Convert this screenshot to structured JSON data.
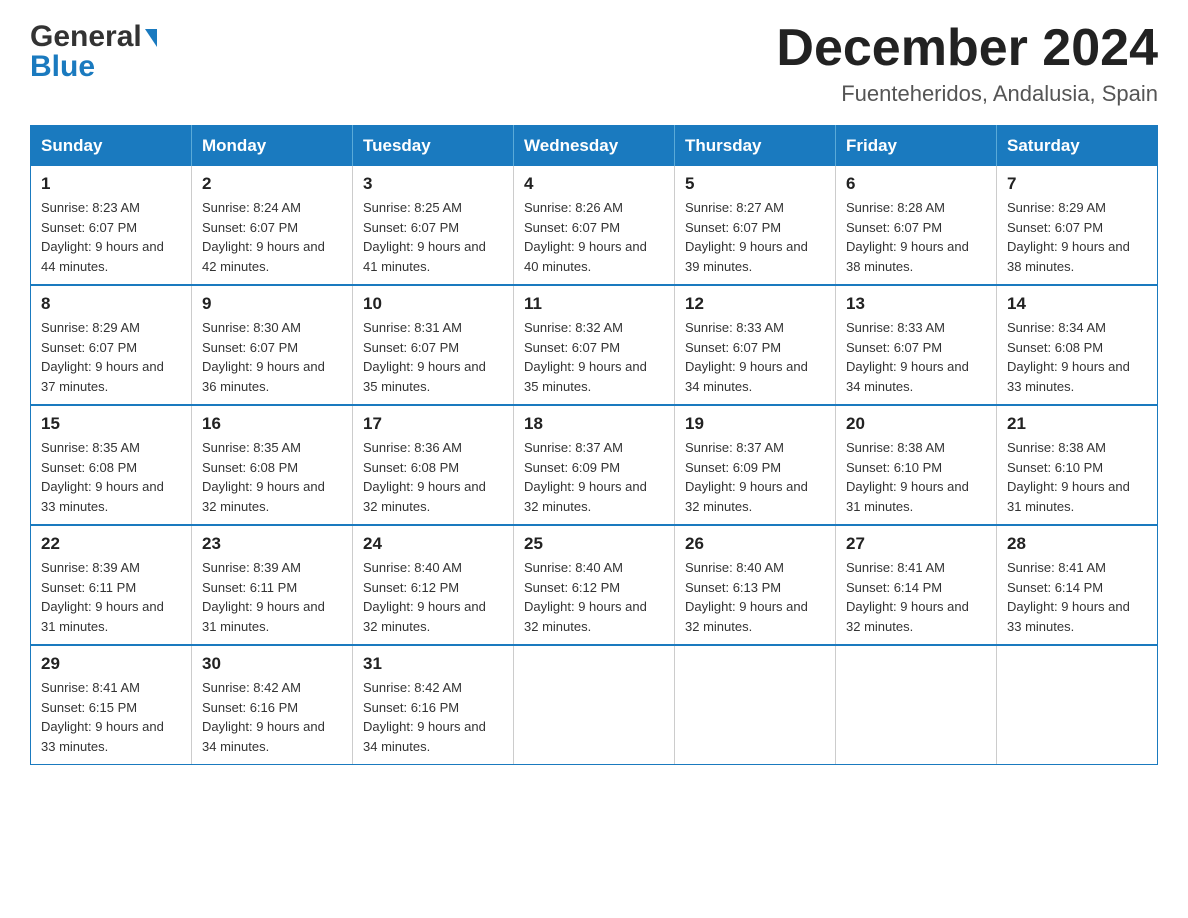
{
  "header": {
    "logo_general": "General",
    "logo_blue": "Blue",
    "main_title": "December 2024",
    "subtitle": "Fuenteheridos, Andalusia, Spain"
  },
  "calendar": {
    "days_of_week": [
      "Sunday",
      "Monday",
      "Tuesday",
      "Wednesday",
      "Thursday",
      "Friday",
      "Saturday"
    ],
    "weeks": [
      [
        {
          "day": "1",
          "sunrise": "Sunrise: 8:23 AM",
          "sunset": "Sunset: 6:07 PM",
          "daylight": "Daylight: 9 hours and 44 minutes."
        },
        {
          "day": "2",
          "sunrise": "Sunrise: 8:24 AM",
          "sunset": "Sunset: 6:07 PM",
          "daylight": "Daylight: 9 hours and 42 minutes."
        },
        {
          "day": "3",
          "sunrise": "Sunrise: 8:25 AM",
          "sunset": "Sunset: 6:07 PM",
          "daylight": "Daylight: 9 hours and 41 minutes."
        },
        {
          "day": "4",
          "sunrise": "Sunrise: 8:26 AM",
          "sunset": "Sunset: 6:07 PM",
          "daylight": "Daylight: 9 hours and 40 minutes."
        },
        {
          "day": "5",
          "sunrise": "Sunrise: 8:27 AM",
          "sunset": "Sunset: 6:07 PM",
          "daylight": "Daylight: 9 hours and 39 minutes."
        },
        {
          "day": "6",
          "sunrise": "Sunrise: 8:28 AM",
          "sunset": "Sunset: 6:07 PM",
          "daylight": "Daylight: 9 hours and 38 minutes."
        },
        {
          "day": "7",
          "sunrise": "Sunrise: 8:29 AM",
          "sunset": "Sunset: 6:07 PM",
          "daylight": "Daylight: 9 hours and 38 minutes."
        }
      ],
      [
        {
          "day": "8",
          "sunrise": "Sunrise: 8:29 AM",
          "sunset": "Sunset: 6:07 PM",
          "daylight": "Daylight: 9 hours and 37 minutes."
        },
        {
          "day": "9",
          "sunrise": "Sunrise: 8:30 AM",
          "sunset": "Sunset: 6:07 PM",
          "daylight": "Daylight: 9 hours and 36 minutes."
        },
        {
          "day": "10",
          "sunrise": "Sunrise: 8:31 AM",
          "sunset": "Sunset: 6:07 PM",
          "daylight": "Daylight: 9 hours and 35 minutes."
        },
        {
          "day": "11",
          "sunrise": "Sunrise: 8:32 AM",
          "sunset": "Sunset: 6:07 PM",
          "daylight": "Daylight: 9 hours and 35 minutes."
        },
        {
          "day": "12",
          "sunrise": "Sunrise: 8:33 AM",
          "sunset": "Sunset: 6:07 PM",
          "daylight": "Daylight: 9 hours and 34 minutes."
        },
        {
          "day": "13",
          "sunrise": "Sunrise: 8:33 AM",
          "sunset": "Sunset: 6:07 PM",
          "daylight": "Daylight: 9 hours and 34 minutes."
        },
        {
          "day": "14",
          "sunrise": "Sunrise: 8:34 AM",
          "sunset": "Sunset: 6:08 PM",
          "daylight": "Daylight: 9 hours and 33 minutes."
        }
      ],
      [
        {
          "day": "15",
          "sunrise": "Sunrise: 8:35 AM",
          "sunset": "Sunset: 6:08 PM",
          "daylight": "Daylight: 9 hours and 33 minutes."
        },
        {
          "day": "16",
          "sunrise": "Sunrise: 8:35 AM",
          "sunset": "Sunset: 6:08 PM",
          "daylight": "Daylight: 9 hours and 32 minutes."
        },
        {
          "day": "17",
          "sunrise": "Sunrise: 8:36 AM",
          "sunset": "Sunset: 6:08 PM",
          "daylight": "Daylight: 9 hours and 32 minutes."
        },
        {
          "day": "18",
          "sunrise": "Sunrise: 8:37 AM",
          "sunset": "Sunset: 6:09 PM",
          "daylight": "Daylight: 9 hours and 32 minutes."
        },
        {
          "day": "19",
          "sunrise": "Sunrise: 8:37 AM",
          "sunset": "Sunset: 6:09 PM",
          "daylight": "Daylight: 9 hours and 32 minutes."
        },
        {
          "day": "20",
          "sunrise": "Sunrise: 8:38 AM",
          "sunset": "Sunset: 6:10 PM",
          "daylight": "Daylight: 9 hours and 31 minutes."
        },
        {
          "day": "21",
          "sunrise": "Sunrise: 8:38 AM",
          "sunset": "Sunset: 6:10 PM",
          "daylight": "Daylight: 9 hours and 31 minutes."
        }
      ],
      [
        {
          "day": "22",
          "sunrise": "Sunrise: 8:39 AM",
          "sunset": "Sunset: 6:11 PM",
          "daylight": "Daylight: 9 hours and 31 minutes."
        },
        {
          "day": "23",
          "sunrise": "Sunrise: 8:39 AM",
          "sunset": "Sunset: 6:11 PM",
          "daylight": "Daylight: 9 hours and 31 minutes."
        },
        {
          "day": "24",
          "sunrise": "Sunrise: 8:40 AM",
          "sunset": "Sunset: 6:12 PM",
          "daylight": "Daylight: 9 hours and 32 minutes."
        },
        {
          "day": "25",
          "sunrise": "Sunrise: 8:40 AM",
          "sunset": "Sunset: 6:12 PM",
          "daylight": "Daylight: 9 hours and 32 minutes."
        },
        {
          "day": "26",
          "sunrise": "Sunrise: 8:40 AM",
          "sunset": "Sunset: 6:13 PM",
          "daylight": "Daylight: 9 hours and 32 minutes."
        },
        {
          "day": "27",
          "sunrise": "Sunrise: 8:41 AM",
          "sunset": "Sunset: 6:14 PM",
          "daylight": "Daylight: 9 hours and 32 minutes."
        },
        {
          "day": "28",
          "sunrise": "Sunrise: 8:41 AM",
          "sunset": "Sunset: 6:14 PM",
          "daylight": "Daylight: 9 hours and 33 minutes."
        }
      ],
      [
        {
          "day": "29",
          "sunrise": "Sunrise: 8:41 AM",
          "sunset": "Sunset: 6:15 PM",
          "daylight": "Daylight: 9 hours and 33 minutes."
        },
        {
          "day": "30",
          "sunrise": "Sunrise: 8:42 AM",
          "sunset": "Sunset: 6:16 PM",
          "daylight": "Daylight: 9 hours and 34 minutes."
        },
        {
          "day": "31",
          "sunrise": "Sunrise: 8:42 AM",
          "sunset": "Sunset: 6:16 PM",
          "daylight": "Daylight: 9 hours and 34 minutes."
        },
        {
          "day": "",
          "sunrise": "",
          "sunset": "",
          "daylight": ""
        },
        {
          "day": "",
          "sunrise": "",
          "sunset": "",
          "daylight": ""
        },
        {
          "day": "",
          "sunrise": "",
          "sunset": "",
          "daylight": ""
        },
        {
          "day": "",
          "sunrise": "",
          "sunset": "",
          "daylight": ""
        }
      ]
    ]
  }
}
